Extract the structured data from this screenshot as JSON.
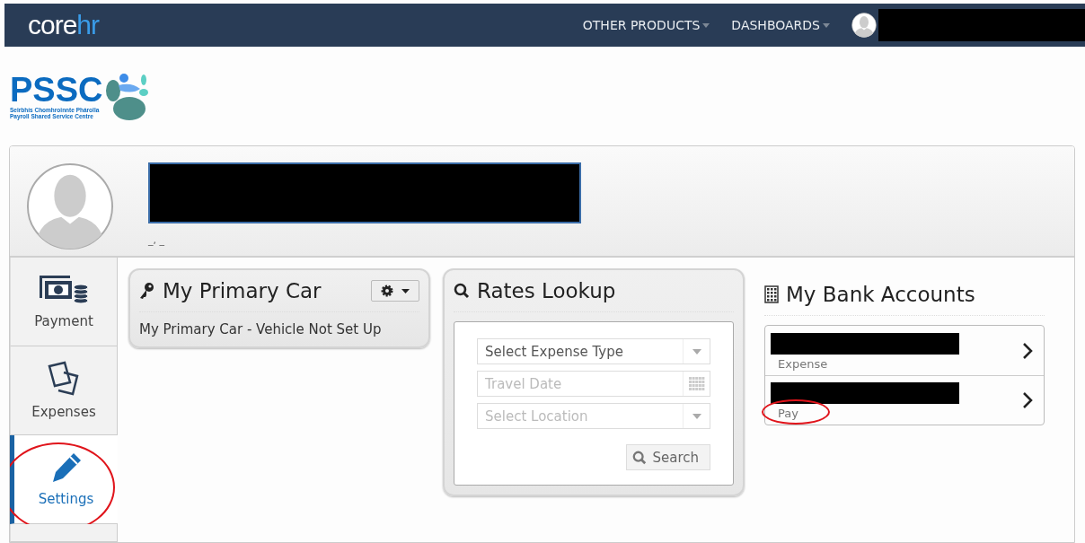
{
  "topbar": {
    "logo": {
      "part_1": "core",
      "part_2": "hr"
    },
    "nav": [
      {
        "label": "OTHER PRODUCTS"
      },
      {
        "label": "DASHBOARDS"
      }
    ],
    "user": {
      "redacted": true
    }
  },
  "org_logo": {
    "name": "PSSC",
    "line_1": "Seirbhís Chomhroinnte Phárolla",
    "line_2": "Payroll Shared Service Centre"
  },
  "profile": {
    "name_redacted": true,
    "subtitle": "_, _"
  },
  "sidebar": {
    "tabs": [
      {
        "kind": "payment",
        "label": "Payment",
        "selected": false,
        "circled": false
      },
      {
        "kind": "expenses",
        "label": "Expenses",
        "selected": false,
        "circled": false
      },
      {
        "kind": "settings",
        "label": "Settings",
        "selected": true,
        "circled": true
      },
      {
        "kind": "blank",
        "selected": false,
        "circled": false
      }
    ]
  },
  "primary_car": {
    "title": "My Primary Car",
    "text": "My Primary Car - Vehicle Not Set Up"
  },
  "rates_lookup": {
    "title": "Rates Lookup",
    "fields": [
      {
        "kind": "select",
        "placeholder": "Select Expense Type",
        "disabled": false
      },
      {
        "kind": "date",
        "placeholder": "Travel Date",
        "disabled": true
      },
      {
        "kind": "select",
        "placeholder": "Select Location",
        "disabled": true
      }
    ],
    "button": "Search"
  },
  "bank_accounts": {
    "title": "My Bank Accounts",
    "accounts": [
      {
        "type": "Expense",
        "redacted": true,
        "circled": false
      },
      {
        "type": "Pay",
        "redacted": true,
        "circled": true
      }
    ]
  }
}
